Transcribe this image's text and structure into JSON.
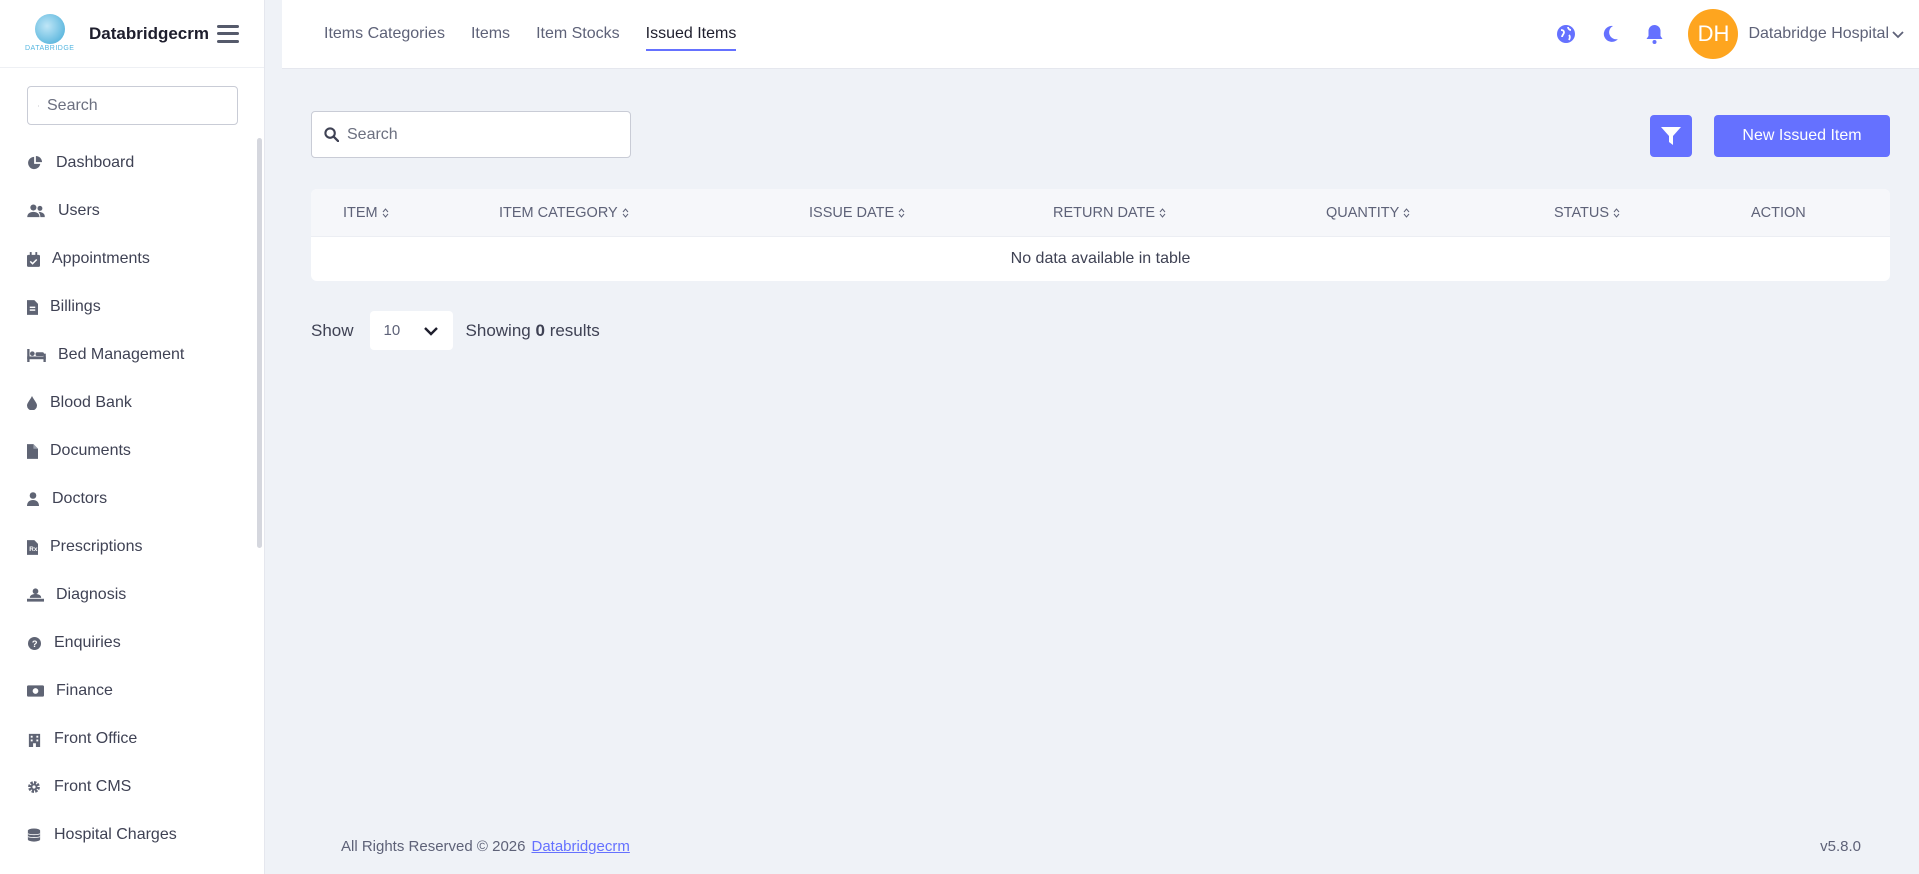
{
  "brand": {
    "name": "Databridgecrm",
    "logo_text": "DATABRIDGE"
  },
  "sidebar": {
    "search_placeholder": "Search",
    "items": [
      {
        "label": "Dashboard",
        "icon": "pie-chart-icon"
      },
      {
        "label": "Users",
        "icon": "users-icon"
      },
      {
        "label": "Appointments",
        "icon": "calendar-check-icon"
      },
      {
        "label": "Billings",
        "icon": "file-invoice-icon"
      },
      {
        "label": "Bed Management",
        "icon": "bed-icon"
      },
      {
        "label": "Blood Bank",
        "icon": "droplet-icon"
      },
      {
        "label": "Documents",
        "icon": "file-icon"
      },
      {
        "label": "Doctors",
        "icon": "user-doctor-icon"
      },
      {
        "label": "Prescriptions",
        "icon": "prescription-icon"
      },
      {
        "label": "Diagnosis",
        "icon": "diagnosis-icon"
      },
      {
        "label": "Enquiries",
        "icon": "question-circle-icon"
      },
      {
        "label": "Finance",
        "icon": "money-icon"
      },
      {
        "label": "Front Office",
        "icon": "building-icon"
      },
      {
        "label": "Front CMS",
        "icon": "gear-icon"
      },
      {
        "label": "Hospital Charges",
        "icon": "coins-icon"
      }
    ]
  },
  "header": {
    "tabs": [
      {
        "label": "Items Categories"
      },
      {
        "label": "Items"
      },
      {
        "label": "Item Stocks"
      },
      {
        "label": "Issued Items"
      }
    ],
    "active_tab": "Issued Items",
    "avatar_initials": "DH",
    "user_name": "Databridge Hospital"
  },
  "main": {
    "search_placeholder": "Search",
    "new_button_label": "New Issued Item",
    "table": {
      "columns": [
        "ITEM",
        "ITEM CATEGORY",
        "ISSUE DATE",
        "RETURN DATE",
        "QUANTITY",
        "STATUS",
        "ACTION"
      ],
      "empty_message": "No data available in table"
    },
    "pager": {
      "show_label": "Show",
      "page_size": "10",
      "showing_prefix": "Showing",
      "showing_count": "0",
      "showing_suffix": "results"
    }
  },
  "footer": {
    "copyright": "All Rights Reserved © 2026",
    "link_text": "Databridgecrm",
    "version": "v5.8.0"
  },
  "colors": {
    "accent": "#6571ff",
    "avatar": "#fea51f",
    "background": "#eff2f7"
  }
}
